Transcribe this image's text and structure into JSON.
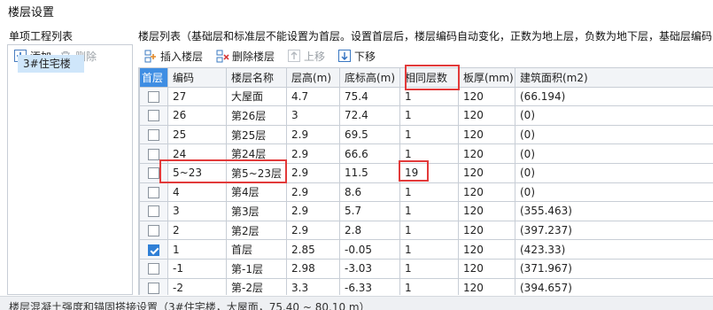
{
  "window": {
    "title": "楼层设置"
  },
  "left_panel": {
    "title": "单项工程列表",
    "add_label": "添加",
    "delete_label": "删除",
    "items": [
      "3#住宅楼"
    ]
  },
  "right_panel": {
    "title": "楼层列表（基础层和标准层不能设置为首层。设置首层后，楼层编码自动变化，正数为地上层，负数为地下层，基础层编码",
    "toolbar": {
      "insert_label": "插入楼层",
      "delete_label": "删除楼层",
      "up_label": "上移",
      "down_label": "下移"
    },
    "columns": [
      "首层",
      "编码",
      "楼层名称",
      "层高(m)",
      "底标高(m)",
      "相同层数",
      "板厚(mm)",
      "建筑面积(m2)"
    ],
    "rows": [
      {
        "first": false,
        "code": "27",
        "name": "大屋面",
        "height": "4.7",
        "base": "75.4",
        "same": "1",
        "slab": "120",
        "area": "(66.194)"
      },
      {
        "first": false,
        "code": "26",
        "name": "第26层",
        "height": "3",
        "base": "72.4",
        "same": "1",
        "slab": "120",
        "area": "(0)"
      },
      {
        "first": false,
        "code": "25",
        "name": "第25层",
        "height": "2.9",
        "base": "69.5",
        "same": "1",
        "slab": "120",
        "area": "(0)"
      },
      {
        "first": false,
        "code": "24",
        "name": "第24层",
        "height": "2.9",
        "base": "66.6",
        "same": "1",
        "slab": "120",
        "area": "(0)"
      },
      {
        "first": false,
        "code": "5~23",
        "name": "第5~23层",
        "height": "2.9",
        "base": "11.5",
        "same": "19",
        "slab": "120",
        "area": "(0)"
      },
      {
        "first": false,
        "code": "4",
        "name": "第4层",
        "height": "2.9",
        "base": "8.6",
        "same": "1",
        "slab": "120",
        "area": "(0)"
      },
      {
        "first": false,
        "code": "3",
        "name": "第3层",
        "height": "2.9",
        "base": "5.7",
        "same": "1",
        "slab": "120",
        "area": "(355.463)"
      },
      {
        "first": false,
        "code": "2",
        "name": "第2层",
        "height": "2.9",
        "base": "2.8",
        "same": "1",
        "slab": "120",
        "area": "(397.237)"
      },
      {
        "first": true,
        "code": "1",
        "name": "首层",
        "height": "2.85",
        "base": "-0.05",
        "same": "1",
        "slab": "120",
        "area": "(423.33)"
      },
      {
        "first": false,
        "code": "-1",
        "name": "第-1层",
        "height": "2.98",
        "base": "-3.03",
        "same": "1",
        "slab": "120",
        "area": "(371.967)"
      },
      {
        "first": false,
        "code": "-2",
        "name": "第-2层",
        "height": "3.3",
        "base": "-6.33",
        "same": "1",
        "slab": "120",
        "area": "(394.657)"
      },
      {
        "first": false,
        "code": "",
        "name": "",
        "height": "",
        "base": "",
        "same": "",
        "slab": "",
        "area": ""
      }
    ]
  },
  "bottom": {
    "text": "楼层混凝土强度和锚固搭接设置（3#住宅楼，大屋面，75.40 ~ 80.10 m）"
  },
  "colors": {
    "accent": "#3f8ee3",
    "highlight": "#e23a3a",
    "selection": "#cfe6fa"
  }
}
